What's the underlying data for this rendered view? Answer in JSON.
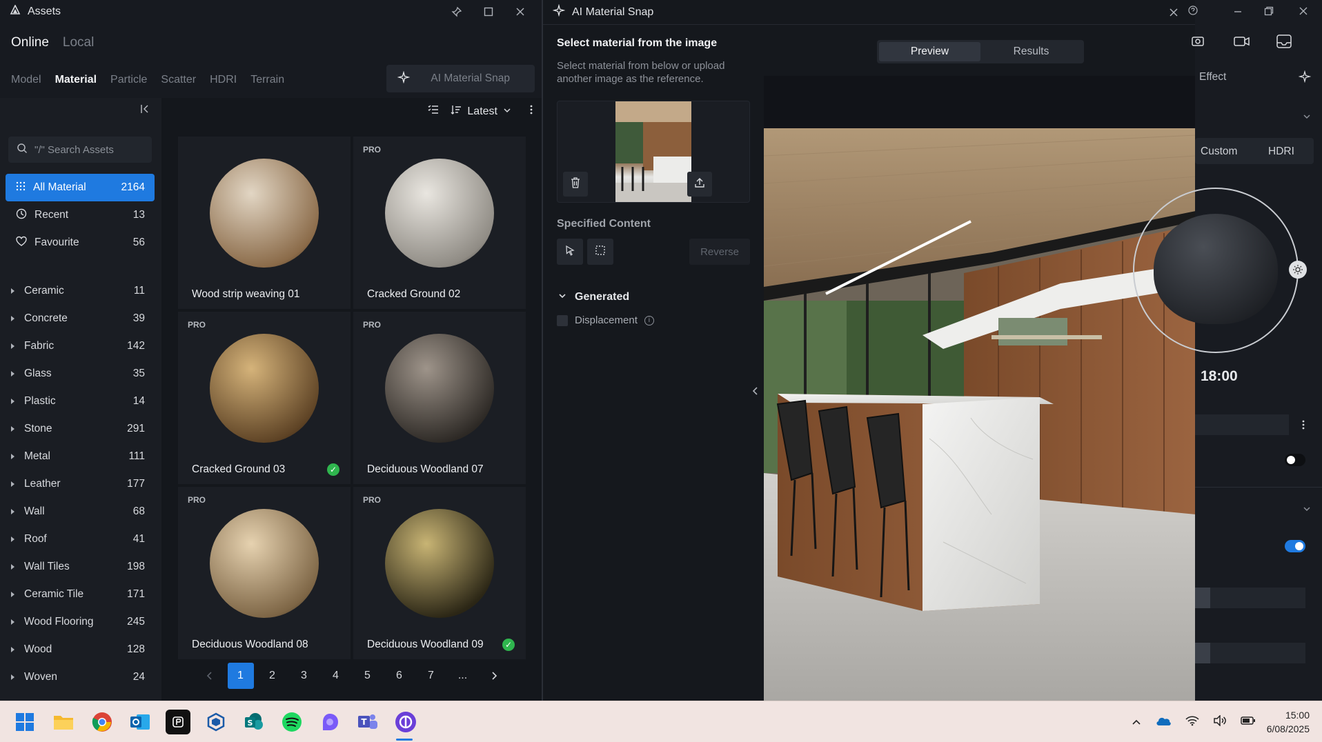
{
  "assets": {
    "title": "Assets",
    "source_tabs": [
      "Online",
      "Local"
    ],
    "category_tabs": [
      "Model",
      "Material",
      "Particle",
      "Scatter",
      "HDRI",
      "Terrain"
    ],
    "snap_button": "AI Material Snap",
    "search_placeholder": "\"/\" Search Assets",
    "nav": [
      {
        "label": "All Material",
        "count": "2164"
      },
      {
        "label": "Recent",
        "count": "13"
      },
      {
        "label": "Favourite",
        "count": "56"
      }
    ],
    "categories": [
      {
        "label": "Ceramic",
        "count": "11"
      },
      {
        "label": "Concrete",
        "count": "39"
      },
      {
        "label": "Fabric",
        "count": "142"
      },
      {
        "label": "Glass",
        "count": "35"
      },
      {
        "label": "Plastic",
        "count": "14"
      },
      {
        "label": "Stone",
        "count": "291"
      },
      {
        "label": "Metal",
        "count": "111"
      },
      {
        "label": "Leather",
        "count": "177"
      },
      {
        "label": "Wall",
        "count": "68"
      },
      {
        "label": "Roof",
        "count": "41"
      },
      {
        "label": "Wall Tiles",
        "count": "198"
      },
      {
        "label": "Ceramic Tile",
        "count": "171"
      },
      {
        "label": "Wood Flooring",
        "count": "245"
      },
      {
        "label": "Wood",
        "count": "128"
      },
      {
        "label": "Woven",
        "count": "24"
      }
    ],
    "sort_label": "Latest",
    "pro_badge": "PRO",
    "cards": [
      {
        "name": "Wood strip weaving 01",
        "pro": false,
        "checked": false,
        "c1": "#e2d6c4",
        "c2": "#8a6a48"
      },
      {
        "name": "Cracked Ground 02",
        "pro": true,
        "checked": false,
        "c1": "#e9e6e0",
        "c2": "#8f8b84"
      },
      {
        "name": "Cracked Ground 03",
        "pro": true,
        "checked": true,
        "c1": "#d5b37a",
        "c2": "#5e4325"
      },
      {
        "name": "Deciduous Woodland 07",
        "pro": true,
        "checked": false,
        "c1": "#9e948a",
        "c2": "#2e2a26"
      },
      {
        "name": "Deciduous Woodland 08",
        "pro": true,
        "checked": false,
        "c1": "#e6d2b0",
        "c2": "#7d6545"
      },
      {
        "name": "Deciduous Woodland 09",
        "pro": true,
        "checked": true,
        "c1": "#c8b474",
        "c2": "#2c2716"
      }
    ],
    "pagination": [
      "1",
      "2",
      "3",
      "4",
      "5",
      "6",
      "7",
      "..."
    ]
  },
  "snap": {
    "title": "AI Material Snap",
    "heading": "Select material from the image",
    "description": "Select material from below or upload another image as the reference.",
    "specified_content": "Specified Content",
    "reverse": "Reverse",
    "generated": "Generated",
    "displacement": "Displacement",
    "tabs": [
      "Preview",
      "Results"
    ]
  },
  "right_panel": {
    "effect": "Effect",
    "custom": "Custom",
    "hdri": "HDRI",
    "time": "18:00"
  },
  "taskbar": {
    "time": "15:00",
    "date": "6/08/2025"
  },
  "colors": {
    "accent": "#1f7ae0",
    "success": "#2fb54e"
  }
}
